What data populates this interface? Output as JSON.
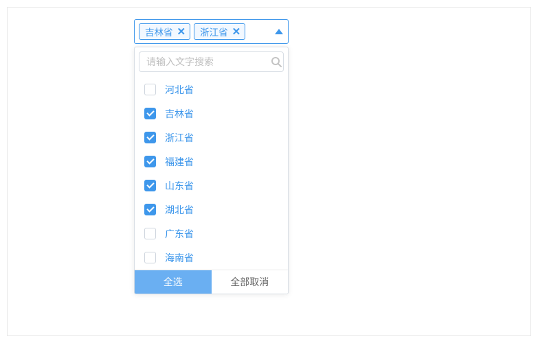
{
  "tags": [
    {
      "label": "吉林省"
    },
    {
      "label": "浙江省"
    }
  ],
  "search": {
    "placeholder": "请输入文字搜索"
  },
  "options": [
    {
      "label": "河北省",
      "checked": false
    },
    {
      "label": "吉林省",
      "checked": true
    },
    {
      "label": "浙江省",
      "checked": true
    },
    {
      "label": "福建省",
      "checked": true
    },
    {
      "label": "山东省",
      "checked": true
    },
    {
      "label": "湖北省",
      "checked": true
    },
    {
      "label": "广东省",
      "checked": false
    },
    {
      "label": "海南省",
      "checked": false
    }
  ],
  "footer": {
    "select_all": "全选",
    "deselect_all": "全部取消"
  }
}
